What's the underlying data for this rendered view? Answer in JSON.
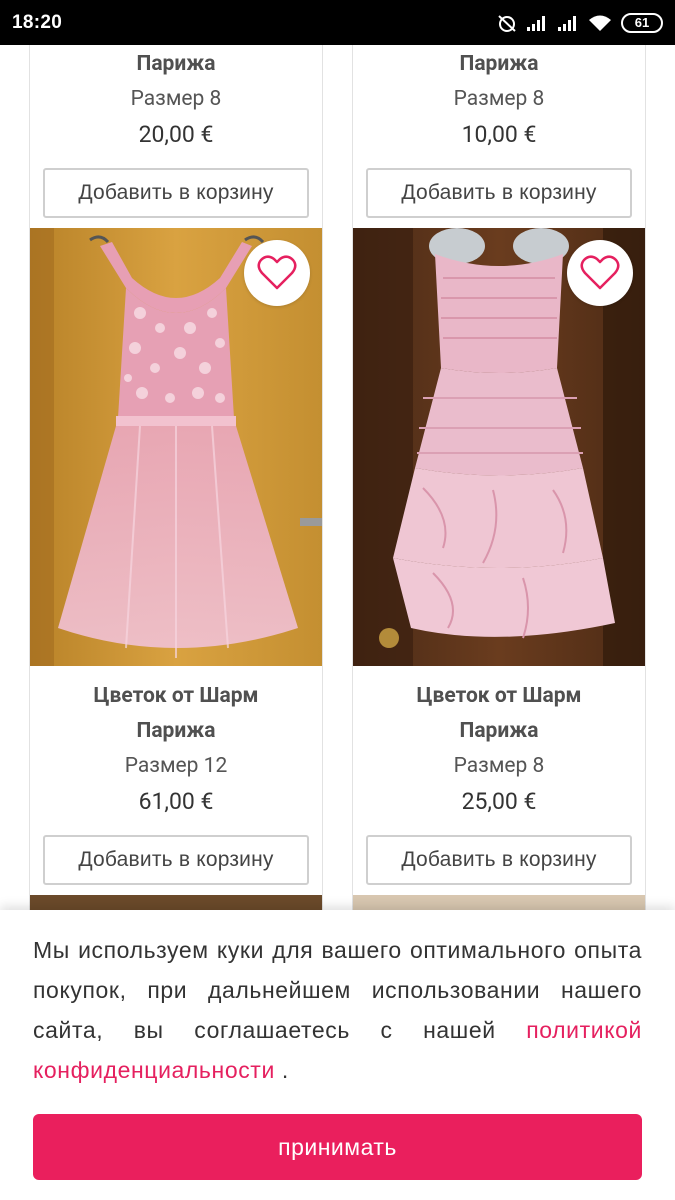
{
  "status_bar": {
    "time": "18:20",
    "battery": "61"
  },
  "products_top": [
    {
      "title_line2": "Парижа",
      "size": "Размер 8",
      "price": "20,00 €",
      "cart_label": "Добавить в корзину"
    },
    {
      "title_line2": "Парижа",
      "size": "Размер 8",
      "price": "10,00 €",
      "cart_label": "Добавить в корзину"
    }
  ],
  "products_mid": [
    {
      "title_line1": "Цветок от Шарм",
      "title_line2": "Парижа",
      "size": "Размер 12",
      "price": "61,00 €",
      "cart_label": "Добавить в корзину",
      "image_desc": "pink tulle dress with lace bodice"
    },
    {
      "title_line1": "Цветок от Шарм",
      "title_line2": "Парижа",
      "size": "Размер 8",
      "price": "25,00 €",
      "cart_label": "Добавить в корзину",
      "image_desc": "pink strapless taffeta dress"
    }
  ],
  "icons": {
    "favorite": "heart-outline-icon"
  },
  "cookie_banner": {
    "text": "Мы используем куки для вашего оптимального опыта покупок, при дальнейшем использовании нашего сайта, вы соглашаетесь с нашей",
    "link_text": "политикой конфиденциальности",
    "text_after": " .",
    "accept_label": "принимать"
  },
  "colors": {
    "accent": "#ea1f5d",
    "link": "#e5205f"
  }
}
